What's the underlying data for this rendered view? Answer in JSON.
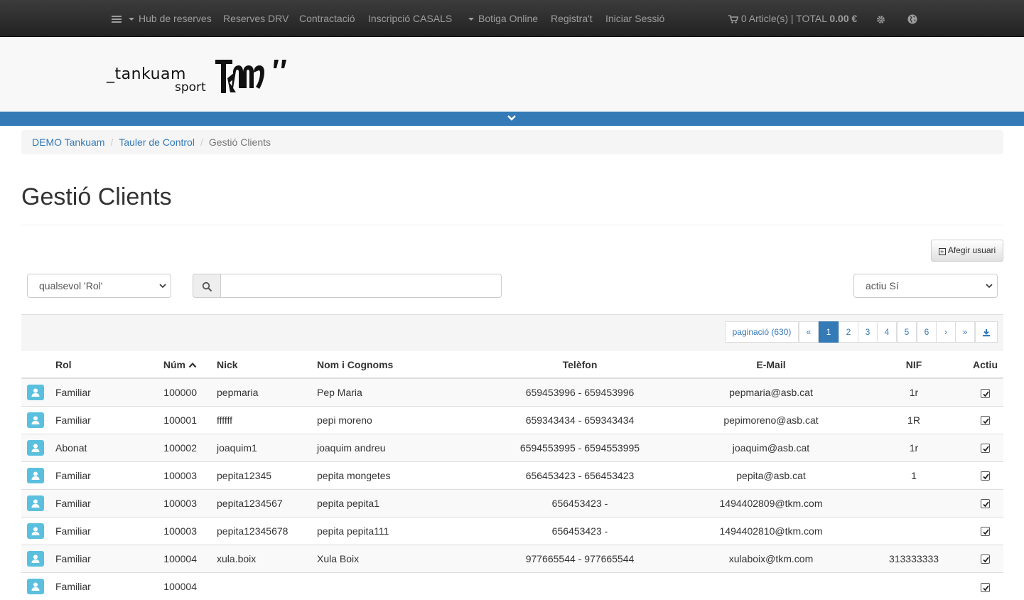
{
  "navbar": {
    "items": [
      {
        "label": "Hub de reserves",
        "dropdown": true
      },
      {
        "label": "Reserves DRV"
      },
      {
        "label": "Contractació"
      },
      {
        "label": "Inscripció CASALS"
      },
      {
        "label": "Botiga Online",
        "dropdown": true
      },
      {
        "label": "Registra't"
      },
      {
        "label": "Iniciar Sessió"
      }
    ],
    "cart_prefix": "0 Article(s) | TOTAL ",
    "cart_total": "0.00 €"
  },
  "logo": {
    "word": "_tankuam",
    "sub": "sport",
    "mark": "TKM"
  },
  "breadcrumb": [
    "DEMO Tankuam",
    "Tauler de Control",
    "Gestió Clients"
  ],
  "page_title": "Gestió Clients",
  "add_user_label": "Afegir usuari",
  "filters": {
    "role_select": "qualsevol 'Rol'",
    "search_value": "",
    "active_select": "actiu Sí"
  },
  "pagination": {
    "label": "paginació (630)",
    "first": "«",
    "pages": [
      "1",
      "2",
      "3",
      "4",
      "5",
      "6"
    ],
    "current": "1",
    "next": "›",
    "last": "»"
  },
  "table": {
    "headers": [
      "Rol",
      "Núm",
      "Nick",
      "Nom i Cognoms",
      "Telèfon",
      "E-Mail",
      "NIF",
      "Actiu"
    ],
    "rows": [
      {
        "rol": "Familiar",
        "num": "100000",
        "nick": "pepmaria",
        "nom": "Pep Maria",
        "tel": "659453996 - 659453996",
        "mail": "pepmaria@asb.cat",
        "nif": "1r",
        "actiu": true
      },
      {
        "rol": "Familiar",
        "num": "100001",
        "nick": "ffffff",
        "nom": "pepi moreno",
        "tel": "659343434 - 659343434",
        "mail": "pepimoreno@asb.cat",
        "nif": "1R",
        "actiu": true
      },
      {
        "rol": "Abonat",
        "num": "100002",
        "nick": "joaquim1",
        "nom": "joaquim andreu",
        "tel": "6594553995 - 6594553995",
        "mail": "joaquim@asb.cat",
        "nif": "1r",
        "actiu": true
      },
      {
        "rol": "Familiar",
        "num": "100003",
        "nick": "pepita12345",
        "nom": "pepita mongetes",
        "tel": "656453423 - 656453423",
        "mail": "pepita@asb.cat",
        "nif": "1",
        "actiu": true
      },
      {
        "rol": "Familiar",
        "num": "100003",
        "nick": "pepita1234567",
        "nom": "pepita pepita1",
        "tel": "656453423 -",
        "mail": "1494402809@tkm.com",
        "nif": "",
        "actiu": true
      },
      {
        "rol": "Familiar",
        "num": "100003",
        "nick": "pepita12345678",
        "nom": "pepita pepita111",
        "tel": "656453423 -",
        "mail": "1494402810@tkm.com",
        "nif": "",
        "actiu": true
      },
      {
        "rol": "Familiar",
        "num": "100004",
        "nick": "xula.boix",
        "nom": "Xula Boix",
        "tel": "977665544 - 977665544",
        "mail": "xulaboix@tkm.com",
        "nif": "313333333",
        "actiu": true
      },
      {
        "rol": "Familiar",
        "num": "100004",
        "nick": "",
        "nom": "",
        "tel": "",
        "mail": "",
        "nif": "",
        "actiu": true
      }
    ]
  }
}
